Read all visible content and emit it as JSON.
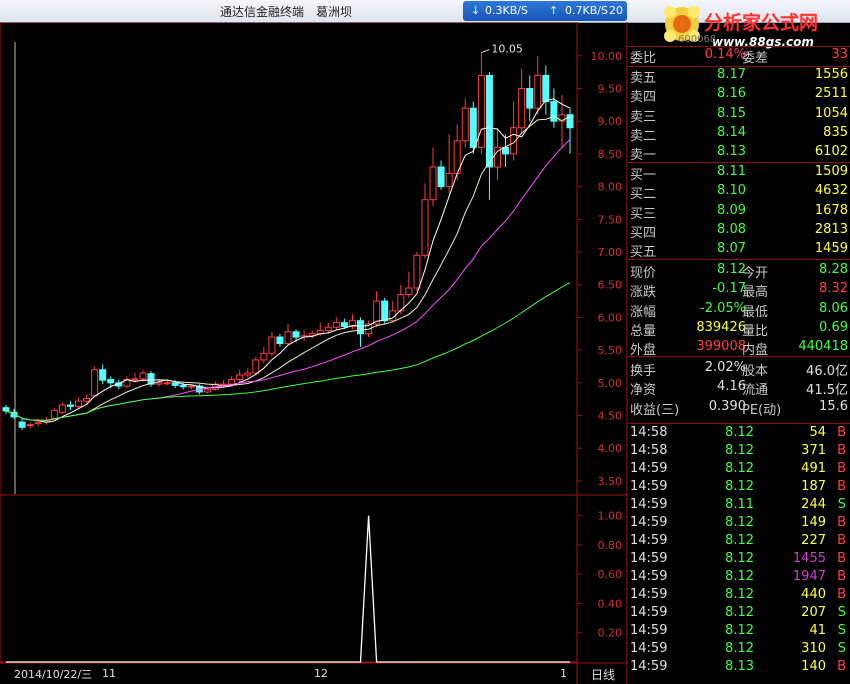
{
  "window": {
    "app_name": "通达信金融终端",
    "stock_name": "葛洲坝",
    "upload_speed": "0.3KB/S",
    "download_speed": "0.7KB/S",
    "speed_tail": "20",
    "stock_code_partial": "600068"
  },
  "logo": {
    "title": "分析家公式网",
    "url": "www.88gs.com"
  },
  "chart_data": {
    "type": "candlestick",
    "price_axis": [
      "10.00",
      "9.50",
      "9.00",
      "8.50",
      "8.00",
      "7.50",
      "7.00",
      "6.50",
      "6.00",
      "5.50",
      "5.00",
      "4.50",
      "4.00",
      "3.50"
    ],
    "ylim": [
      3.3,
      10.15
    ],
    "high_label": "10.05",
    "x_labels": [
      "11",
      "12",
      "1"
    ],
    "date_label": "2014/10/22/三",
    "period_label": "日线",
    "candles": [
      [
        4.62,
        4.57,
        4.66,
        4.52
      ],
      [
        4.55,
        4.48,
        4.6,
        4.45
      ],
      [
        4.4,
        4.32,
        4.45,
        4.28
      ],
      [
        4.35,
        4.36,
        4.4,
        4.3
      ],
      [
        4.38,
        4.4,
        4.45,
        4.34
      ],
      [
        4.4,
        4.42,
        4.48,
        4.36
      ],
      [
        4.46,
        4.58,
        4.62,
        4.44
      ],
      [
        4.55,
        4.66,
        4.7,
        4.52
      ],
      [
        4.66,
        4.64,
        4.72,
        4.58
      ],
      [
        4.64,
        4.72,
        4.78,
        4.6
      ],
      [
        4.72,
        4.76,
        4.82,
        4.68
      ],
      [
        4.8,
        5.2,
        5.25,
        4.78
      ],
      [
        5.2,
        5.04,
        5.28,
        4.98
      ],
      [
        5.05,
        5.0,
        5.1,
        4.92
      ],
      [
        5.0,
        4.95,
        5.05,
        4.9
      ],
      [
        4.95,
        5.05,
        5.1,
        4.92
      ],
      [
        5.05,
        5.06,
        5.15,
        5.0
      ],
      [
        5.06,
        5.15,
        5.2,
        5.02
      ],
      [
        5.14,
        4.98,
        5.18,
        4.94
      ],
      [
        4.98,
        5.0,
        5.05,
        4.94
      ],
      [
        5.0,
        5.0,
        5.06,
        4.96
      ],
      [
        5.0,
        4.96,
        5.04,
        4.92
      ],
      [
        4.96,
        4.94,
        5.0,
        4.9
      ],
      [
        4.94,
        4.95,
        4.98,
        4.9
      ],
      [
        4.95,
        4.86,
        4.98,
        4.82
      ],
      [
        4.86,
        4.9,
        4.94,
        4.84
      ],
      [
        4.9,
        4.98,
        5.02,
        4.88
      ],
      [
        4.98,
        4.98,
        5.04,
        4.94
      ],
      [
        4.98,
        5.05,
        5.1,
        4.95
      ],
      [
        5.05,
        5.12,
        5.2,
        5.0
      ],
      [
        5.12,
        5.15,
        5.22,
        5.08
      ],
      [
        5.15,
        5.35,
        5.4,
        5.12
      ],
      [
        5.35,
        5.45,
        5.55,
        5.3
      ],
      [
        5.45,
        5.7,
        5.78,
        5.4
      ],
      [
        5.7,
        5.6,
        5.75,
        5.55
      ],
      [
        5.6,
        5.78,
        5.9,
        5.58
      ],
      [
        5.78,
        5.7,
        5.82,
        5.62
      ],
      [
        5.7,
        5.72,
        5.8,
        5.64
      ],
      [
        5.72,
        5.75,
        5.8,
        5.68
      ],
      [
        5.75,
        5.8,
        5.92,
        5.72
      ],
      [
        5.8,
        5.85,
        5.92,
        5.75
      ],
      [
        5.85,
        5.92,
        6.0,
        5.8
      ],
      [
        5.92,
        5.86,
        5.98,
        5.82
      ],
      [
        5.86,
        5.95,
        6.05,
        5.82
      ],
      [
        5.95,
        5.75,
        6.0,
        5.55
      ],
      [
        5.75,
        5.9,
        5.95,
        5.7
      ],
      [
        5.9,
        6.25,
        6.4,
        5.85
      ],
      [
        6.25,
        5.95,
        6.3,
        5.9
      ],
      [
        5.95,
        6.1,
        6.25,
        5.92
      ],
      [
        6.1,
        6.35,
        6.5,
        6.05
      ],
      [
        6.35,
        6.45,
        6.7,
        6.3
      ],
      [
        6.45,
        6.95,
        7.0,
        6.4
      ],
      [
        6.95,
        7.8,
        8.05,
        6.9
      ],
      [
        7.8,
        8.3,
        8.6,
        7.7
      ],
      [
        8.3,
        8.0,
        8.4,
        7.95
      ],
      [
        8.0,
        8.2,
        8.8,
        7.9
      ],
      [
        8.2,
        8.7,
        8.95,
        8.1
      ],
      [
        8.7,
        9.2,
        9.35,
        8.6
      ],
      [
        9.2,
        8.6,
        9.3,
        8.5
      ],
      [
        8.6,
        9.7,
        10.05,
        8.5
      ],
      [
        9.7,
        8.3,
        9.75,
        7.8
      ],
      [
        8.3,
        8.6,
        8.9,
        8.1
      ],
      [
        8.6,
        8.5,
        8.8,
        8.3
      ],
      [
        8.5,
        8.9,
        9.3,
        8.4
      ],
      [
        8.9,
        9.5,
        9.8,
        8.8
      ],
      [
        9.5,
        9.2,
        9.7,
        9.0
      ],
      [
        9.2,
        9.7,
        10.0,
        9.1
      ],
      [
        9.7,
        9.3,
        9.85,
        9.1
      ],
      [
        9.3,
        9.0,
        9.5,
        8.9
      ],
      [
        9.0,
        9.1,
        9.4,
        8.6
      ],
      [
        9.1,
        8.9,
        9.2,
        8.5
      ]
    ],
    "oscillator_axis": [
      "1.00",
      "0.80",
      "0.60",
      "0.40",
      "0.20"
    ],
    "oscillator_ylim": [
      0,
      1.1
    ],
    "oscillator_spike_index": 45
  },
  "quote": {
    "rows": [
      {
        "label": "委比",
        "value": "0.14%",
        "label2": "委差",
        "value2": "33",
        "c1": "#ff4040",
        "c2": "#ff4040"
      },
      {
        "label": "卖五",
        "value": "8.17",
        "label2": "",
        "value2": "1556",
        "c1": "#40ff40",
        "c2": "#ffff40"
      },
      {
        "label": "卖四",
        "value": "8.16",
        "label2": "",
        "value2": "2511",
        "c1": "#40ff40",
        "c2": "#ffff40"
      },
      {
        "label": "卖三",
        "value": "8.15",
        "label2": "",
        "value2": "1054",
        "c1": "#40ff40",
        "c2": "#ffff40"
      },
      {
        "label": "卖二",
        "value": "8.14",
        "label2": "",
        "value2": "835",
        "c1": "#40ff40",
        "c2": "#ffff40"
      },
      {
        "label": "卖一",
        "value": "8.13",
        "label2": "",
        "value2": "6102",
        "c1": "#40ff40",
        "c2": "#ffff40"
      },
      {
        "label": "买一",
        "value": "8.11",
        "label2": "",
        "value2": "1509",
        "c1": "#40ff40",
        "c2": "#ffff40"
      },
      {
        "label": "买二",
        "value": "8.10",
        "label2": "",
        "value2": "4632",
        "c1": "#40ff40",
        "c2": "#ffff40"
      },
      {
        "label": "买三",
        "value": "8.09",
        "label2": "",
        "value2": "1678",
        "c1": "#40ff40",
        "c2": "#ffff40"
      },
      {
        "label": "买四",
        "value": "8.08",
        "label2": "",
        "value2": "2813",
        "c1": "#40ff40",
        "c2": "#ffff40"
      },
      {
        "label": "买五",
        "value": "8.07",
        "label2": "",
        "value2": "1459",
        "c1": "#40ff40",
        "c2": "#ffff40"
      },
      {
        "label": "现价",
        "value": "8.12",
        "label2": "今开",
        "value2": "8.28",
        "c1": "#40ff40",
        "c2": "#40ff40"
      },
      {
        "label": "涨跌",
        "value": "-0.17",
        "label2": "最高",
        "value2": "8.32",
        "c1": "#40ff40",
        "c2": "#ff4040"
      },
      {
        "label": "涨幅",
        "value": "-2.05%",
        "label2": "最低",
        "value2": "8.06",
        "c1": "#40ff40",
        "c2": "#40ff40"
      },
      {
        "label": "总量",
        "value": "839426",
        "label2": "量比",
        "value2": "0.69",
        "c1": "#ffff40",
        "c2": "#40ff40"
      },
      {
        "label": "外盘",
        "value": "399008",
        "label2": "内盘",
        "value2": "440418",
        "c1": "#ff4040",
        "c2": "#40ff40"
      },
      {
        "label": "换手",
        "value": "2.02%",
        "label2": "股本",
        "value2": "46.0亿",
        "c1": "#e0e0e0",
        "c2": "#e0e0e0"
      },
      {
        "label": "净资",
        "value": "4.16",
        "label2": "流通",
        "value2": "41.5亿",
        "c1": "#e0e0e0",
        "c2": "#e0e0e0"
      },
      {
        "label": "收益(三)",
        "value": "0.390",
        "label2": "PE(动)",
        "value2": "15.6",
        "c1": "#e0e0e0",
        "c2": "#e0e0e0"
      }
    ]
  },
  "ticks": [
    {
      "time": "14:58",
      "price": "8.12",
      "vol": "54",
      "bs": "B",
      "vc": "#ffff40"
    },
    {
      "time": "14:58",
      "price": "8.12",
      "vol": "371",
      "bs": "B",
      "vc": "#ffff40"
    },
    {
      "time": "14:59",
      "price": "8.12",
      "vol": "491",
      "bs": "B",
      "vc": "#ffff40"
    },
    {
      "time": "14:59",
      "price": "8.12",
      "vol": "187",
      "bs": "B",
      "vc": "#ffff40"
    },
    {
      "time": "14:59",
      "price": "8.11",
      "vol": "244",
      "bs": "S",
      "vc": "#ffff40"
    },
    {
      "time": "14:59",
      "price": "8.12",
      "vol": "149",
      "bs": "B",
      "vc": "#ffff40"
    },
    {
      "time": "14:59",
      "price": "8.12",
      "vol": "227",
      "bs": "B",
      "vc": "#ffff40"
    },
    {
      "time": "14:59",
      "price": "8.12",
      "vol": "1455",
      "bs": "B",
      "vc": "#d040d0"
    },
    {
      "time": "14:59",
      "price": "8.12",
      "vol": "1947",
      "bs": "B",
      "vc": "#d040d0"
    },
    {
      "time": "14:59",
      "price": "8.12",
      "vol": "440",
      "bs": "B",
      "vc": "#ffff40"
    },
    {
      "time": "14:59",
      "price": "8.12",
      "vol": "207",
      "bs": "S",
      "vc": "#ffff40"
    },
    {
      "time": "14:59",
      "price": "8.12",
      "vol": "41",
      "bs": "S",
      "vc": "#ffff40"
    },
    {
      "time": "14:59",
      "price": "8.12",
      "vol": "310",
      "bs": "S",
      "vc": "#ffff40"
    },
    {
      "time": "14:59",
      "price": "8.13",
      "vol": "140",
      "bs": "B",
      "vc": "#ffff40"
    }
  ],
  "colors": {
    "up": "#ff3c3c",
    "down": "#54ffff",
    "ma5": "#ffffff",
    "ma10": "#ffff60",
    "ma20": "#ff50ff",
    "ma60": "#40ff40",
    "grid": "#a01010",
    "buy": "#ff4040",
    "sell": "#40ff40"
  }
}
